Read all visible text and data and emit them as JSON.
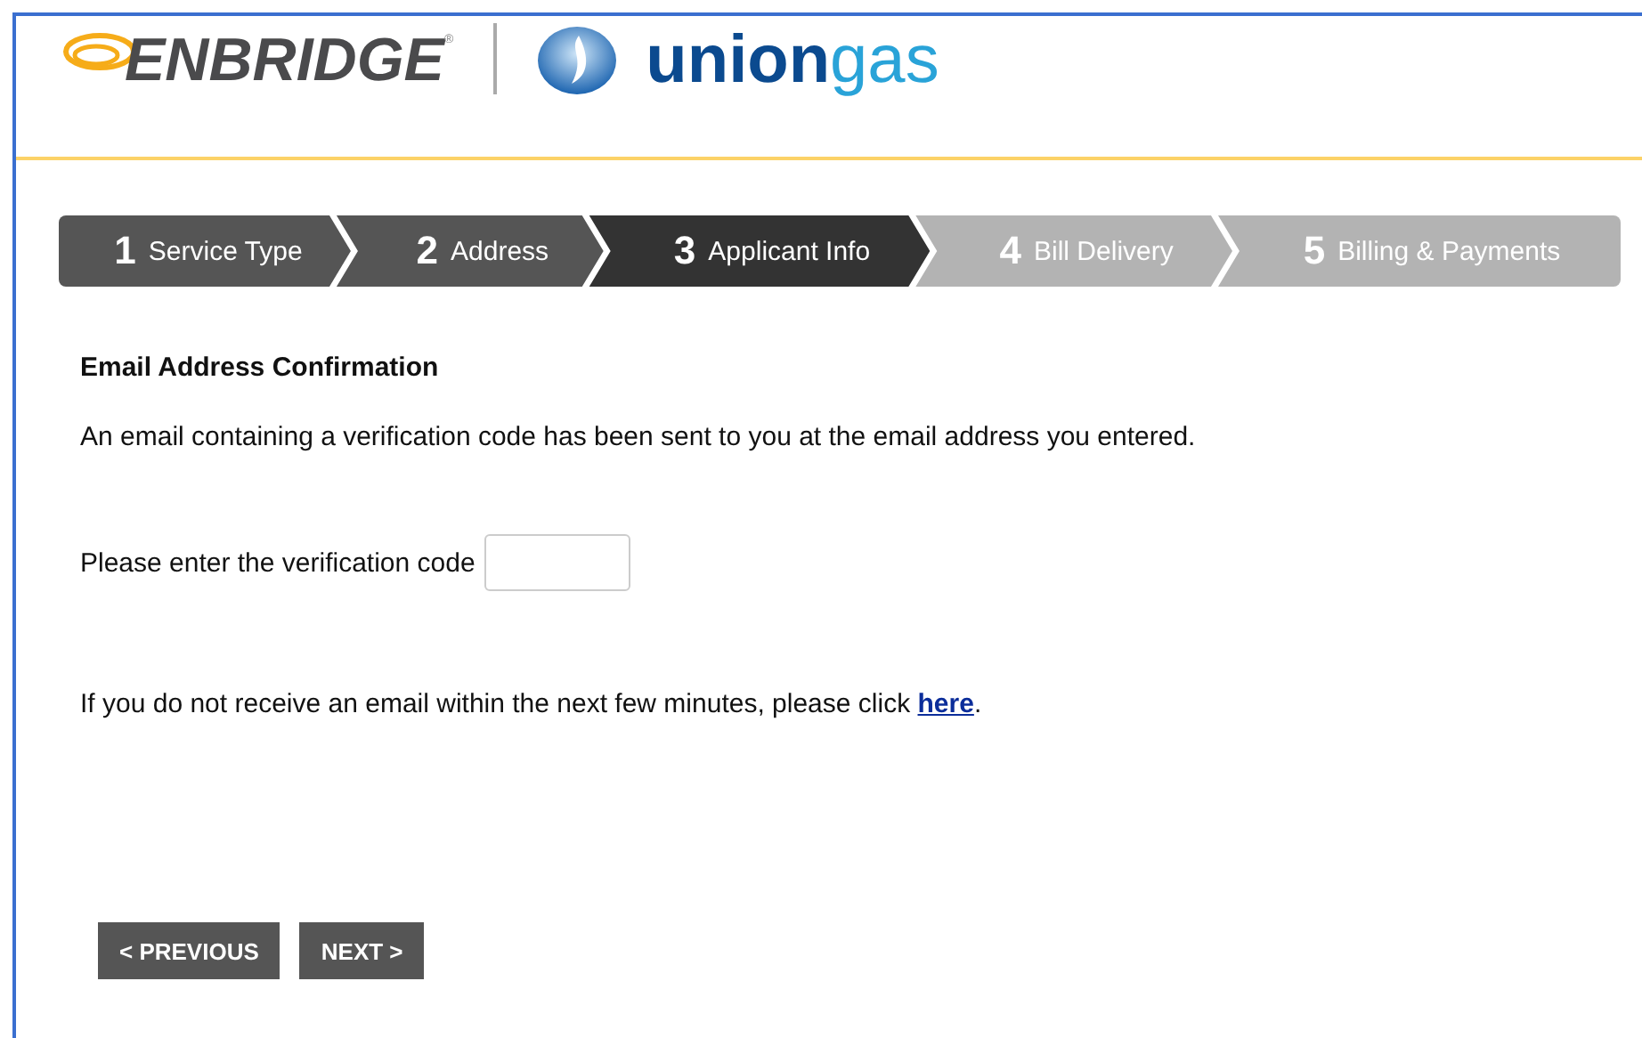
{
  "header": {
    "logo_primary": "ENBRIDGE",
    "logo_mark": "®",
    "logo_secondary_a": "union",
    "logo_secondary_b": "gas"
  },
  "steps": [
    {
      "number": "1",
      "label": "Service Type",
      "selected": false,
      "disabled": false
    },
    {
      "number": "2",
      "label": "Address",
      "selected": false,
      "disabled": false
    },
    {
      "number": "3",
      "label": "Applicant Info",
      "selected": true,
      "disabled": false
    },
    {
      "number": "4",
      "label": "Bill Delivery",
      "selected": false,
      "disabled": true
    },
    {
      "number": "5",
      "label": "Billing & Payments",
      "selected": false,
      "disabled": true
    }
  ],
  "form": {
    "heading": "Email Address Confirmation",
    "message": "An email containing a verification code has been sent to you at the email address you entered.",
    "code_label": "Please enter the verification code",
    "resend_text": "If you do not receive an email within the next few minutes, please click ",
    "resend_link": "here",
    "resend_end": "."
  },
  "buttons": [
    {
      "label": "< PREVIOUS"
    },
    {
      "label": "NEXT >"
    }
  ]
}
